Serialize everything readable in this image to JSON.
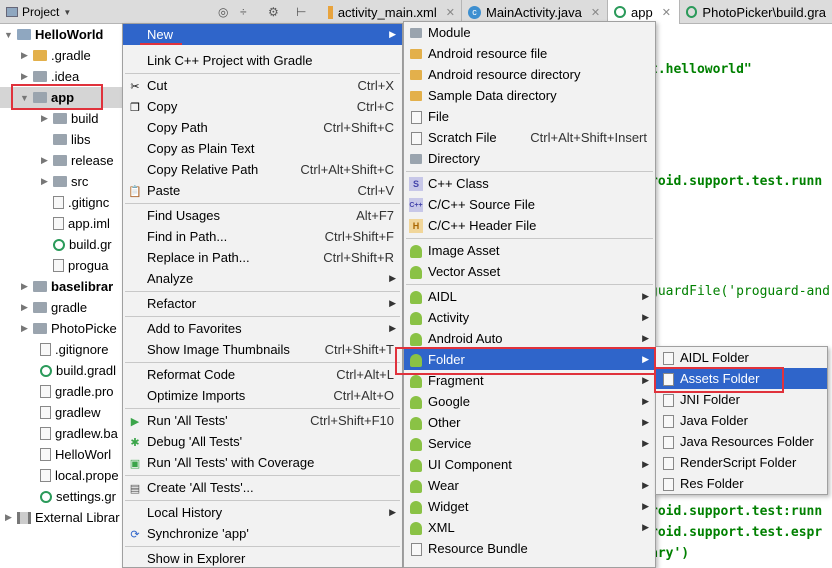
{
  "toolbar": {
    "project_label": "Project",
    "tabs": [
      {
        "label": "activity_main.xml"
      },
      {
        "label": "MainActivity.java"
      },
      {
        "label": "app"
      },
      {
        "label": "PhotoPicker\\build.gra"
      }
    ]
  },
  "tree": {
    "items": [
      {
        "label": "HelloWorld"
      },
      {
        "label": ".gradle"
      },
      {
        "label": ".idea"
      },
      {
        "label": "app"
      },
      {
        "label": "build"
      },
      {
        "label": "libs"
      },
      {
        "label": "release"
      },
      {
        "label": "src"
      },
      {
        "label": ".gitignc"
      },
      {
        "label": "app.iml"
      },
      {
        "label": "build.gr"
      },
      {
        "label": "progua"
      },
      {
        "label": "baselibrar"
      },
      {
        "label": "gradle"
      },
      {
        "label": "PhotoPicke"
      },
      {
        "label": ".gitignore"
      },
      {
        "label": "build.gradl"
      },
      {
        "label": "gradle.pro"
      },
      {
        "label": "gradlew"
      },
      {
        "label": "gradlew.ba"
      },
      {
        "label": "HelloWorl"
      },
      {
        "label": "local.prope"
      },
      {
        "label": "settings.gr"
      },
      {
        "label": "External Librar"
      }
    ]
  },
  "editor": {
    "lines": [
      "t.helloworld\"",
      "roid.support.test.runn",
      "guardFile('proguard-and",
      "roid.support.test:runn",
      "roid.support.test.espr",
      "ary')"
    ]
  },
  "context_menu": {
    "items": [
      {
        "label": "New",
        "shortcut": ""
      },
      {
        "label": "Link C++ Project with Gradle",
        "shortcut": ""
      },
      {
        "label": "Cut",
        "shortcut": "Ctrl+X"
      },
      {
        "label": "Copy",
        "shortcut": "Ctrl+C"
      },
      {
        "label": "Copy Path",
        "shortcut": "Ctrl+Shift+C"
      },
      {
        "label": "Copy as Plain Text",
        "shortcut": ""
      },
      {
        "label": "Copy Relative Path",
        "shortcut": "Ctrl+Alt+Shift+C"
      },
      {
        "label": "Paste",
        "shortcut": "Ctrl+V"
      },
      {
        "label": "Find Usages",
        "shortcut": "Alt+F7"
      },
      {
        "label": "Find in Path...",
        "shortcut": "Ctrl+Shift+F"
      },
      {
        "label": "Replace in Path...",
        "shortcut": "Ctrl+Shift+R"
      },
      {
        "label": "Analyze",
        "shortcut": ""
      },
      {
        "label": "Refactor",
        "shortcut": ""
      },
      {
        "label": "Add to Favorites",
        "shortcut": ""
      },
      {
        "label": "Show Image Thumbnails",
        "shortcut": "Ctrl+Shift+T"
      },
      {
        "label": "Reformat Code",
        "shortcut": "Ctrl+Alt+L"
      },
      {
        "label": "Optimize Imports",
        "shortcut": "Ctrl+Alt+O"
      },
      {
        "label": "Run 'All Tests'",
        "shortcut": "Ctrl+Shift+F10"
      },
      {
        "label": "Debug 'All Tests'",
        "shortcut": ""
      },
      {
        "label": "Run 'All Tests' with Coverage",
        "shortcut": ""
      },
      {
        "label": "Create 'All Tests'...",
        "shortcut": ""
      },
      {
        "label": "Local History",
        "shortcut": ""
      },
      {
        "label": "Synchronize 'app'",
        "shortcut": ""
      },
      {
        "label": "Show in Explorer",
        "shortcut": ""
      }
    ]
  },
  "new_submenu": {
    "items": [
      {
        "label": "Module",
        "shortcut": ""
      },
      {
        "label": "Android resource file",
        "shortcut": ""
      },
      {
        "label": "Android resource directory",
        "shortcut": ""
      },
      {
        "label": "Sample Data directory",
        "shortcut": ""
      },
      {
        "label": "File",
        "shortcut": ""
      },
      {
        "label": "Scratch File",
        "shortcut": "Ctrl+Alt+Shift+Insert"
      },
      {
        "label": "Directory",
        "shortcut": ""
      },
      {
        "label": "C++ Class",
        "shortcut": ""
      },
      {
        "label": "C/C++ Source File",
        "shortcut": ""
      },
      {
        "label": "C/C++ Header File",
        "shortcut": ""
      },
      {
        "label": "Image Asset",
        "shortcut": ""
      },
      {
        "label": "Vector Asset",
        "shortcut": ""
      },
      {
        "label": "AIDL",
        "shortcut": ""
      },
      {
        "label": "Activity",
        "shortcut": ""
      },
      {
        "label": "Android Auto",
        "shortcut": ""
      },
      {
        "label": "Folder",
        "shortcut": ""
      },
      {
        "label": "Fragment",
        "shortcut": ""
      },
      {
        "label": "Google",
        "shortcut": ""
      },
      {
        "label": "Other",
        "shortcut": ""
      },
      {
        "label": "Service",
        "shortcut": ""
      },
      {
        "label": "UI Component",
        "shortcut": ""
      },
      {
        "label": "Wear",
        "shortcut": ""
      },
      {
        "label": "Widget",
        "shortcut": ""
      },
      {
        "label": "XML",
        "shortcut": ""
      },
      {
        "label": "Resource Bundle",
        "shortcut": ""
      }
    ]
  },
  "folder_submenu": {
    "items": [
      {
        "label": "AIDL Folder"
      },
      {
        "label": "Assets Folder"
      },
      {
        "label": "JNI Folder"
      },
      {
        "label": "Java Folder"
      },
      {
        "label": "Java Resources Folder"
      },
      {
        "label": "RenderScript Folder"
      },
      {
        "label": "Res Folder"
      }
    ]
  },
  "colors": {
    "highlight": "#2f65ca",
    "annotation_red": "#e0323c",
    "menu_bg": "#f2f2f2",
    "android_green": "#8ac245"
  }
}
